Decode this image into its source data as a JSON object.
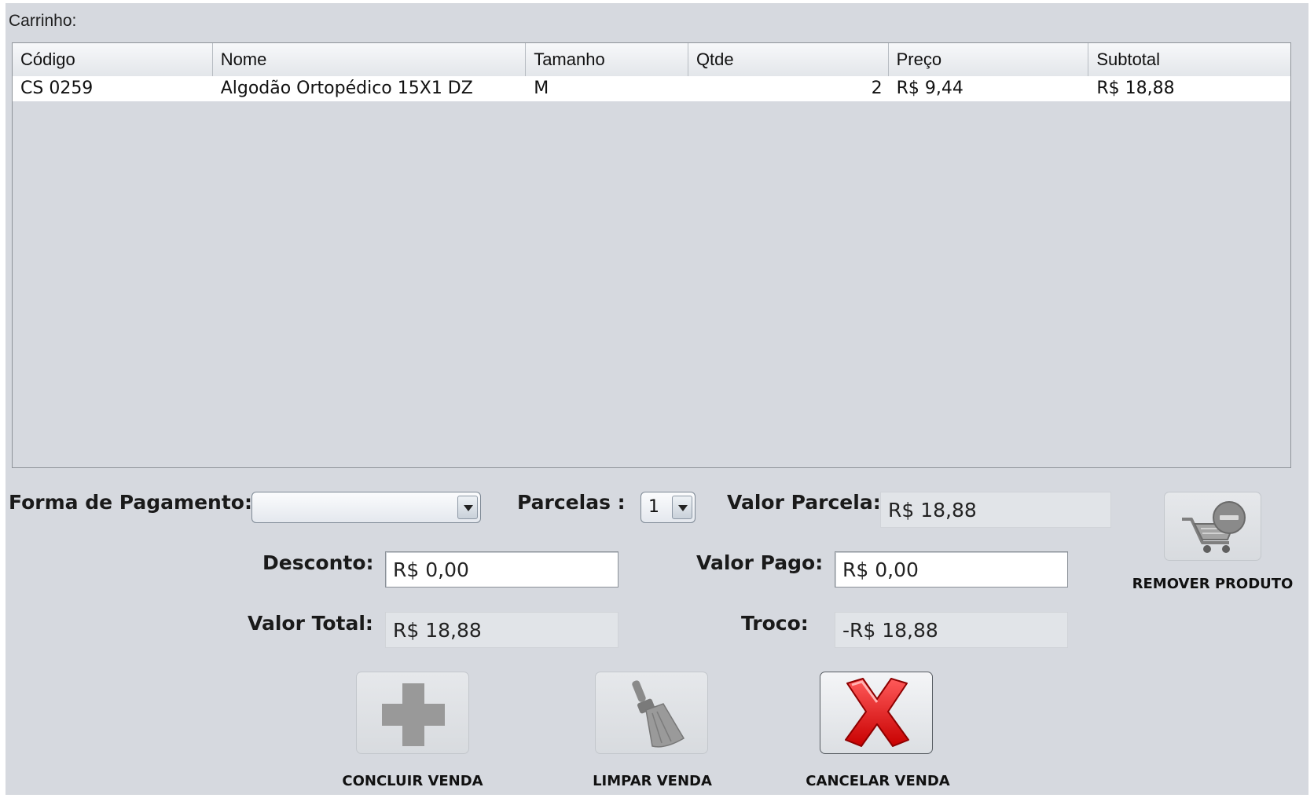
{
  "cart": {
    "label": "Carrinho:",
    "columns": [
      "Código",
      "Nome",
      "Tamanho",
      "Qtde",
      "Preço",
      "Subtotal"
    ],
    "rows": [
      [
        "CS 0259",
        "Algodão Ortopédico 15X1 DZ",
        "M",
        "2",
        "R$ 9,44",
        "R$ 18,88"
      ]
    ]
  },
  "payment": {
    "forma_label": "Forma de Pagamento:",
    "forma_value": "",
    "parcelas_label": "Parcelas :",
    "parcelas_value": "1",
    "valor_parcela_label": "Valor Parcela:",
    "valor_parcela_value": "R$ 18,88",
    "desconto_label": "Desconto:",
    "desconto_value": "R$ 0,00",
    "valor_pago_label": "Valor Pago:",
    "valor_pago_value": "R$ 0,00",
    "valor_total_label": "Valor Total:",
    "valor_total_value": "R$ 18,88",
    "troco_label": "Troco:",
    "troco_value": "-R$ 18,88"
  },
  "actions": {
    "remover": "REMOVER PRODUTO",
    "concluir": "CONCLUIR VENDA",
    "limpar": "LIMPAR VENDA",
    "cancelar": "CANCELAR VENDA"
  },
  "icons": {
    "remover": "cart-remove-icon",
    "concluir": "plus-icon",
    "limpar": "broom-icon",
    "cancelar": "red-x-icon"
  }
}
